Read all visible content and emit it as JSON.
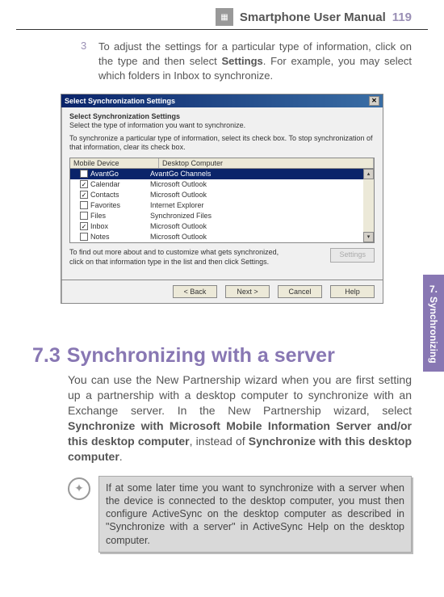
{
  "header": {
    "title": "Smartphone User Manual",
    "page": "119"
  },
  "sideTab": {
    "chapter": "7.",
    "label": "Synchronizing"
  },
  "step": {
    "num": "3",
    "text_before": "To adjust the settings for a particular type of information, click on the type and then select ",
    "bold1": "Settings",
    "text_after": ".  For example, you may select which folders in Inbox to synchronize."
  },
  "dialog": {
    "title": "Select Synchronization Settings",
    "subtitle": "Select Synchronization Settings",
    "subdesc": "Select the type of information you want to synchronize.",
    "desc": "To synchronize a particular type of information, select its check box. To stop synchronization of that information, clear its check box.",
    "columns": {
      "mobile": "Mobile Device",
      "desktop": "Desktop Computer"
    },
    "rows": [
      {
        "checked": false,
        "label": "AvantGo",
        "desktop": "AvantGo Channels",
        "selected": true
      },
      {
        "checked": true,
        "label": "Calendar",
        "desktop": "Microsoft Outlook"
      },
      {
        "checked": true,
        "label": "Contacts",
        "desktop": "Microsoft Outlook"
      },
      {
        "checked": false,
        "label": "Favorites",
        "desktop": "Internet Explorer"
      },
      {
        "checked": false,
        "label": "Files",
        "desktop": "Synchronized Files"
      },
      {
        "checked": true,
        "label": "Inbox",
        "desktop": "Microsoft Outlook"
      },
      {
        "checked": false,
        "label": "Notes",
        "desktop": "Microsoft Outlook"
      }
    ],
    "tip": "To find out more about and to customize what gets synchronized, click on that information type in the list and then click Settings.",
    "settings_btn": "Settings",
    "buttons": {
      "back": "< Back",
      "next": "Next >",
      "cancel": "Cancel",
      "help": "Help"
    }
  },
  "section": {
    "num": "7.3",
    "title": "Synchronizing with a server",
    "p1": "You can use the New Partnership wizard when you are first setting up a partnership with a desktop computer to synchronize with an Exchange server. In the New Partnership wizard, select ",
    "b1": "Synchronize with Microsoft Mobile Information Server and/or this desktop computer",
    "p2": ", instead of ",
    "b2": "Synchronize with this desktop computer",
    "p3": "."
  },
  "note": {
    "text": "If at some later time you want to synchronize with a server when the device is connected to the desktop computer, you must then configure ActiveSync on the desktop computer as described in \"Synchronize with a server\" in ActiveSync Help on the desktop computer."
  }
}
